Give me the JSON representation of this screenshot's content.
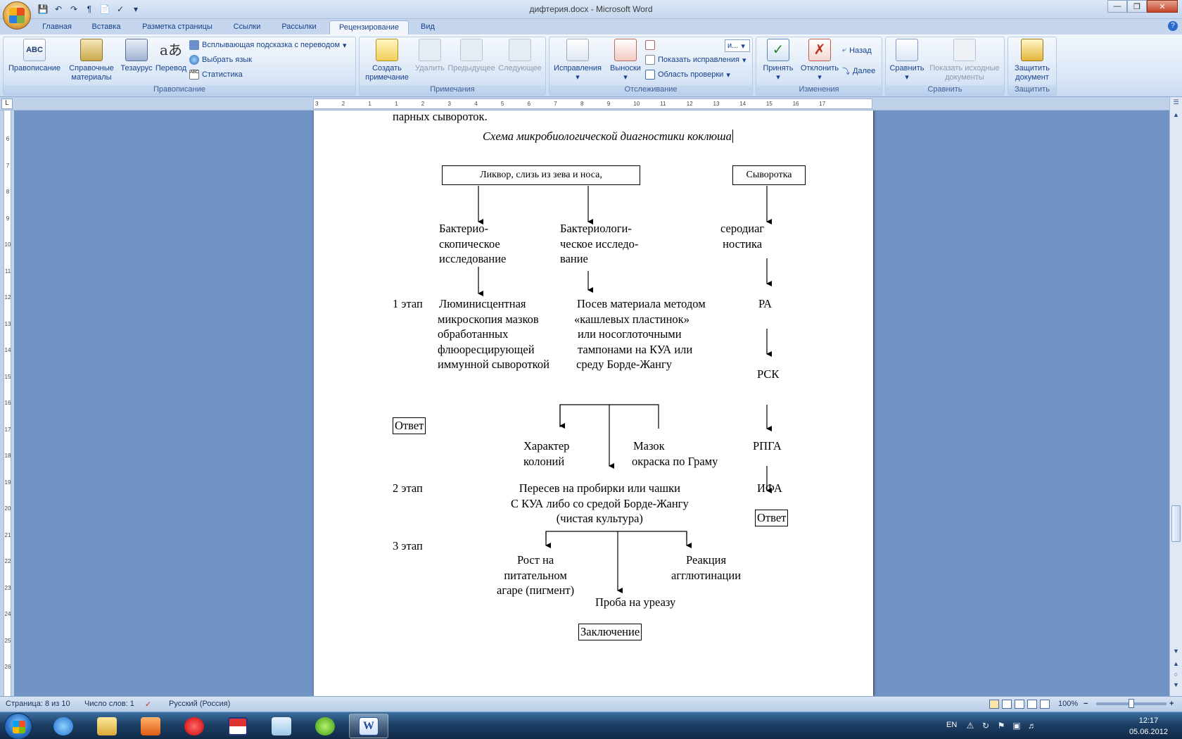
{
  "window": {
    "title": "дифтерия.docx - Microsoft Word"
  },
  "tabs": [
    {
      "label": "Главная"
    },
    {
      "label": "Вставка"
    },
    {
      "label": "Разметка страницы"
    },
    {
      "label": "Ссылки"
    },
    {
      "label": "Рассылки"
    },
    {
      "label": "Рецензирование",
      "active": true
    },
    {
      "label": "Вид"
    }
  ],
  "ribbon": {
    "proofing": {
      "label": "Правописание",
      "spelling": "Правописание",
      "research": "Справочные материалы",
      "thesaurus": "Тезаурус",
      "translate": "Перевод",
      "screentip": "Всплывающая подсказка с переводом",
      "language": "Выбрать язык",
      "stats": "Статистика"
    },
    "comments": {
      "label": "Примечания",
      "new": "Создать примечание",
      "delete": "Удалить",
      "prev": "Предыдущее",
      "next": "Следующее"
    },
    "tracking": {
      "label": "Отслеживание",
      "track": "Исправления",
      "balloons": "Выноски",
      "display": "и...",
      "show_markup": "Показать исправления",
      "pane": "Область проверки"
    },
    "changes": {
      "label": "Изменения",
      "accept": "Принять",
      "reject": "Отклонить",
      "prev": "Назад",
      "next": "Далее"
    },
    "compare": {
      "label": "Сравнить",
      "compare": "Сравнить",
      "show_source": "Показать исходные документы"
    },
    "protect": {
      "label": "Защитить",
      "protect": "Защитить документ"
    }
  },
  "ruler": {
    "h_labels": [
      "3",
      "2",
      "1",
      "1",
      "2",
      "3",
      "4",
      "5",
      "6",
      "7",
      "8",
      "9",
      "10",
      "11",
      "12",
      "13",
      "14",
      "15",
      "16",
      "17"
    ],
    "v_labels": [
      "6",
      "7",
      "8",
      "9",
      "10",
      "11",
      "12",
      "13",
      "14",
      "15",
      "16",
      "17",
      "18",
      "19",
      "20",
      "21",
      "22",
      "23",
      "24",
      "25",
      "26"
    ]
  },
  "document": {
    "prev_line": "парных сывороток.",
    "heading": "Схема микробиологической диагностики коклюша",
    "box_specimen": "Ликвор, слизь из зева и носа,",
    "box_serum": "Сыворотка",
    "bacterioscopic": [
      "Бактерио-",
      "скопическое",
      "исследование"
    ],
    "bacteriological": [
      "Бактериологи-",
      "ческое исследо-",
      "вание"
    ],
    "serodiag": [
      "серодиаг",
      "ностика"
    ],
    "stage1": "1 этап",
    "luminescent": [
      "Люминисцентная",
      "микроскопия мазков",
      "обработанных",
      "флюоресцирующей",
      "иммунной сывороткой"
    ],
    "culture": [
      "Посев материала методом",
      "«кашлевых пластинок»",
      "или носоглоточными",
      "тампонами на КУА или",
      "среду Борде-Жангу"
    ],
    "ra": "РА",
    "rsk": "РСК",
    "answer1": "Ответ",
    "colonies": [
      "Характер",
      "колоний"
    ],
    "smear": [
      "Мазок",
      "окраска по Граму"
    ],
    "rpga": "РПГА",
    "stage2": "2 этап",
    "subculture": [
      "Пересев на пробирки или чашки",
      "С КУА либо со средой Борде-Жангу",
      "(чистая культура)"
    ],
    "ifa": "ИФА",
    "answer2": "Ответ",
    "stage3": "3 этап",
    "growth": [
      "Рост на",
      "питательном",
      "агаре (пигмент)"
    ],
    "agglutination": [
      "Реакция",
      "агглютинации"
    ],
    "urease": "Проба на уреазу",
    "conclusion": "Заключение"
  },
  "statusbar": {
    "page": "Страница: 8 из 10",
    "words": "Число слов: 1",
    "language": "Русский (Россия)",
    "zoom": "100%"
  },
  "taskbar": {
    "lang": "EN",
    "time": "12:17",
    "date": "05.06.2012"
  }
}
